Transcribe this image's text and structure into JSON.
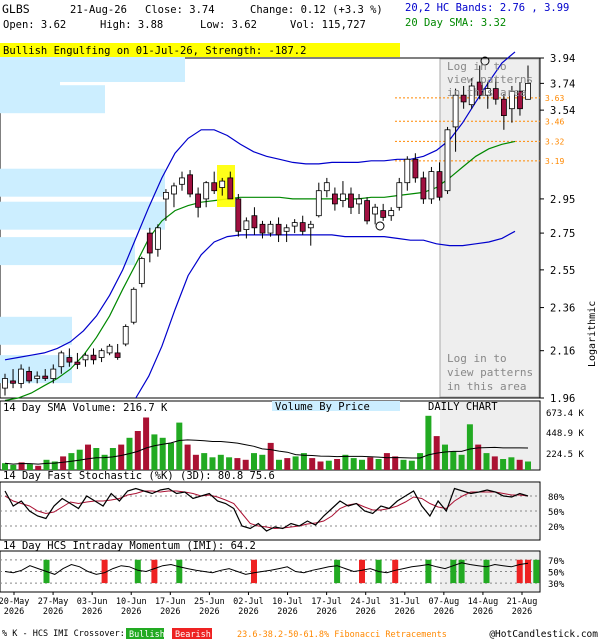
{
  "header": {
    "symbol": "GLBS",
    "date": "21-Aug-26",
    "close_label": "Close: 3.74",
    "change_label": "Change: 0.12 (+3.3 %)",
    "open_label": "Open: 3.62",
    "high_label": "High: 3.88",
    "low_label": "Low: 3.62",
    "vol_label": "Vol: 115,727",
    "bands_label": "20,2 HC Bands: 2.76 , 3.99",
    "sma_label": "20 Day SMA: 3.32"
  },
  "pattern_banner": "Bullish Engulfing on 01-Jul-26, Strength: -187.2",
  "login_text_top": [
    "Log in to",
    "view patterns",
    "in this area"
  ],
  "login_text_bottom": [
    "Log in to",
    "view patterns",
    "in this area"
  ],
  "colors": {
    "bull": "#22aa22",
    "bear": "#aa1133",
    "candle_up": "#ffffff",
    "candle_down": "#a01040",
    "bands": "#0000cc",
    "sma": "#008800",
    "fib": "#ff8800",
    "vbp": "#cceeff",
    "banner": "#ffff00"
  },
  "chart_data": {
    "type": "candlestick",
    "price_axis": {
      "scale": "log",
      "ticks": [
        1.96,
        2.16,
        2.36,
        2.55,
        2.75,
        2.95,
        3.54,
        3.74,
        3.94
      ],
      "label": "Logarithmic"
    },
    "fib_levels": [
      3.63,
      3.46,
      3.32,
      3.19
    ],
    "dates": [
      "20-May",
      "27-May",
      "03-Jun",
      "10-Jun",
      "17-Jun",
      "25-Jun",
      "02-Jul",
      "10-Jul",
      "17-Jul",
      "24-Jul",
      "31-Jul",
      "07-Aug",
      "14-Aug",
      "21-Aug"
    ],
    "date_years": [
      "2026",
      "2026",
      "2026",
      "2026",
      "2026",
      "2026",
      "2026",
      "2026",
      "2026",
      "2026",
      "2026",
      "2026",
      "2026",
      "2026"
    ],
    "candles": [
      {
        "o": 2.0,
        "h": 2.06,
        "l": 1.97,
        "c": 2.04
      },
      {
        "o": 2.03,
        "h": 2.08,
        "l": 2.0,
        "c": 2.02
      },
      {
        "o": 2.02,
        "h": 2.1,
        "l": 2.0,
        "c": 2.08
      },
      {
        "o": 2.07,
        "h": 2.09,
        "l": 2.02,
        "c": 2.03
      },
      {
        "o": 2.04,
        "h": 2.07,
        "l": 2.02,
        "c": 2.05
      },
      {
        "o": 2.05,
        "h": 2.08,
        "l": 2.03,
        "c": 2.04
      },
      {
        "o": 2.04,
        "h": 2.1,
        "l": 2.02,
        "c": 2.08
      },
      {
        "o": 2.09,
        "h": 2.16,
        "l": 2.06,
        "c": 2.15
      },
      {
        "o": 2.13,
        "h": 2.17,
        "l": 2.09,
        "c": 2.11
      },
      {
        "o": 2.11,
        "h": 2.15,
        "l": 2.08,
        "c": 2.1
      },
      {
        "o": 2.12,
        "h": 2.15,
        "l": 2.09,
        "c": 2.14
      },
      {
        "o": 2.14,
        "h": 2.17,
        "l": 2.1,
        "c": 2.12
      },
      {
        "o": 2.13,
        "h": 2.17,
        "l": 2.11,
        "c": 2.16
      },
      {
        "o": 2.15,
        "h": 2.19,
        "l": 2.14,
        "c": 2.18
      },
      {
        "o": 2.15,
        "h": 2.19,
        "l": 2.12,
        "c": 2.13
      },
      {
        "o": 2.19,
        "h": 2.28,
        "l": 2.18,
        "c": 2.27
      },
      {
        "o": 2.29,
        "h": 2.46,
        "l": 2.28,
        "c": 2.45
      },
      {
        "o": 2.48,
        "h": 2.62,
        "l": 2.46,
        "c": 2.61
      },
      {
        "o": 2.75,
        "h": 2.78,
        "l": 2.59,
        "c": 2.64
      },
      {
        "o": 2.66,
        "h": 2.8,
        "l": 2.62,
        "c": 2.78
      },
      {
        "o": 2.95,
        "h": 3.01,
        "l": 2.82,
        "c": 2.99
      },
      {
        "o": 2.98,
        "h": 3.05,
        "l": 2.9,
        "c": 3.03
      },
      {
        "o": 3.04,
        "h": 3.12,
        "l": 3.0,
        "c": 3.08
      },
      {
        "o": 3.1,
        "h": 3.13,
        "l": 2.96,
        "c": 2.98
      },
      {
        "o": 2.98,
        "h": 3.02,
        "l": 2.84,
        "c": 2.9
      },
      {
        "o": 2.95,
        "h": 3.06,
        "l": 2.9,
        "c": 3.05
      },
      {
        "o": 3.05,
        "h": 3.12,
        "l": 2.98,
        "c": 3.0
      },
      {
        "o": 3.02,
        "h": 3.08,
        "l": 2.97,
        "c": 3.06
      },
      {
        "o": 3.08,
        "h": 3.12,
        "l": 3.02,
        "c": 2.95
      },
      {
        "o": 2.95,
        "h": 2.98,
        "l": 2.73,
        "c": 2.76
      },
      {
        "o": 2.77,
        "h": 2.84,
        "l": 2.72,
        "c": 2.82
      },
      {
        "o": 2.85,
        "h": 2.9,
        "l": 2.74,
        "c": 2.78
      },
      {
        "o": 2.8,
        "h": 2.82,
        "l": 2.72,
        "c": 2.75
      },
      {
        "o": 2.75,
        "h": 2.82,
        "l": 2.73,
        "c": 2.8
      },
      {
        "o": 2.8,
        "h": 2.84,
        "l": 2.7,
        "c": 2.74
      },
      {
        "o": 2.76,
        "h": 2.8,
        "l": 2.7,
        "c": 2.78
      },
      {
        "o": 2.79,
        "h": 2.83,
        "l": 2.75,
        "c": 2.81
      },
      {
        "o": 2.81,
        "h": 2.85,
        "l": 2.74,
        "c": 2.76
      },
      {
        "o": 2.78,
        "h": 2.82,
        "l": 2.68,
        "c": 2.8
      },
      {
        "o": 2.85,
        "h": 3.05,
        "l": 2.84,
        "c": 3.0
      },
      {
        "o": 3.0,
        "h": 3.08,
        "l": 2.96,
        "c": 3.05
      },
      {
        "o": 2.98,
        "h": 3.02,
        "l": 2.88,
        "c": 2.92
      },
      {
        "o": 2.94,
        "h": 3.06,
        "l": 2.9,
        "c": 2.98
      },
      {
        "o": 2.98,
        "h": 3.02,
        "l": 2.86,
        "c": 2.9
      },
      {
        "o": 2.92,
        "h": 2.98,
        "l": 2.86,
        "c": 2.95
      },
      {
        "o": 2.94,
        "h": 2.96,
        "l": 2.8,
        "c": 2.82
      },
      {
        "o": 2.86,
        "h": 2.92,
        "l": 2.8,
        "c": 2.9
      },
      {
        "o": 2.88,
        "h": 2.92,
        "l": 2.82,
        "c": 2.84
      },
      {
        "o": 2.85,
        "h": 2.9,
        "l": 2.82,
        "c": 2.88
      },
      {
        "o": 2.9,
        "h": 3.08,
        "l": 2.88,
        "c": 3.05
      },
      {
        "o": 3.05,
        "h": 3.22,
        "l": 3.0,
        "c": 3.2
      },
      {
        "o": 3.2,
        "h": 3.24,
        "l": 3.05,
        "c": 3.08
      },
      {
        "o": 3.08,
        "h": 3.12,
        "l": 2.92,
        "c": 2.95
      },
      {
        "o": 2.95,
        "h": 3.15,
        "l": 2.92,
        "c": 3.12
      },
      {
        "o": 3.12,
        "h": 3.18,
        "l": 2.94,
        "c": 2.96
      },
      {
        "o": 3.0,
        "h": 3.42,
        "l": 2.98,
        "c": 3.4
      },
      {
        "o": 3.42,
        "h": 3.7,
        "l": 3.25,
        "c": 3.65
      },
      {
        "o": 3.65,
        "h": 3.72,
        "l": 3.55,
        "c": 3.6
      },
      {
        "o": 3.58,
        "h": 3.78,
        "l": 3.55,
        "c": 3.72
      },
      {
        "o": 3.75,
        "h": 3.88,
        "l": 3.62,
        "c": 3.65
      },
      {
        "o": 3.65,
        "h": 3.75,
        "l": 3.55,
        "c": 3.7
      },
      {
        "o": 3.7,
        "h": 3.78,
        "l": 3.58,
        "c": 3.62
      },
      {
        "o": 3.62,
        "h": 3.66,
        "l": 3.4,
        "c": 3.5
      },
      {
        "o": 3.55,
        "h": 3.72,
        "l": 3.45,
        "c": 3.68
      },
      {
        "o": 3.68,
        "h": 3.75,
        "l": 3.5,
        "c": 3.55
      },
      {
        "o": 3.62,
        "h": 3.88,
        "l": 3.62,
        "c": 3.74
      }
    ],
    "upper_band": [
      2.12,
      2.13,
      2.14,
      2.15,
      2.17,
      2.2,
      2.25,
      2.32,
      2.42,
      2.55,
      2.72,
      2.9,
      3.08,
      3.24,
      3.34,
      3.4,
      3.4,
      3.36,
      3.3,
      3.25,
      3.22,
      3.2,
      3.18,
      3.17,
      3.17,
      3.18,
      3.18,
      3.18,
      3.19,
      3.19,
      3.2,
      3.2,
      3.22,
      3.26,
      3.33,
      3.45,
      3.6,
      3.75,
      3.9,
      3.99
    ],
    "lower_band": [
      null,
      null,
      null,
      null,
      null,
      null,
      null,
      null,
      null,
      null,
      1.96,
      2.05,
      2.18,
      2.35,
      2.52,
      2.63,
      2.7,
      2.73,
      2.74,
      2.74,
      2.74,
      2.74,
      2.74,
      2.74,
      2.74,
      2.74,
      2.73,
      2.73,
      2.73,
      2.73,
      2.72,
      2.71,
      2.71,
      2.69,
      2.68,
      2.68,
      2.69,
      2.7,
      2.72,
      2.76
    ],
    "sma20": [
      1.95,
      1.96,
      1.98,
      2.01,
      2.04,
      2.08,
      2.14,
      2.22,
      2.32,
      2.45,
      2.58,
      2.72,
      2.82,
      2.88,
      2.91,
      2.93,
      2.94,
      2.95,
      2.96,
      2.96,
      2.96,
      2.96,
      2.95,
      2.95,
      2.95,
      2.95,
      2.95,
      2.95,
      2.96,
      2.96,
      2.97,
      2.98,
      2.99,
      3.02,
      3.08,
      3.15,
      3.22,
      3.27,
      3.3,
      3.32
    ],
    "vbp_bars": [
      {
        "price": 3.86,
        "len": 185
      },
      {
        "price": 3.75,
        "len": 60
      },
      {
        "price": 3.62,
        "len": 105
      },
      {
        "price": 3.35,
        "len": 0
      },
      {
        "price": 3.05,
        "len": 165
      },
      {
        "price": 2.85,
        "len": 165
      },
      {
        "price": 2.65,
        "len": 135
      },
      {
        "price": 2.25,
        "len": 72
      },
      {
        "price": 2.08,
        "len": 72
      }
    ],
    "volume": {
      "title": "14 Day SMA Volume: 216.7 K",
      "axis_ticks": [
        "673.4 K",
        "448.9 K",
        "224.5 K"
      ],
      "subtitle": "Volume By Price",
      "right_label": "DAILY CHART",
      "bars": [
        {
          "v": 80,
          "up": true
        },
        {
          "v": 60,
          "up": true
        },
        {
          "v": 90,
          "up": false
        },
        {
          "v": 70,
          "up": true
        },
        {
          "v": 50,
          "up": false
        },
        {
          "v": 120,
          "up": true
        },
        {
          "v": 100,
          "up": true
        },
        {
          "v": 160,
          "up": false
        },
        {
          "v": 200,
          "up": true
        },
        {
          "v": 240,
          "up": true
        },
        {
          "v": 300,
          "up": false
        },
        {
          "v": 260,
          "up": true
        },
        {
          "v": 180,
          "up": true
        },
        {
          "v": 260,
          "up": true
        },
        {
          "v": 300,
          "up": false
        },
        {
          "v": 380,
          "up": true
        },
        {
          "v": 460,
          "up": false
        },
        {
          "v": 620,
          "up": false
        },
        {
          "v": 420,
          "up": true
        },
        {
          "v": 380,
          "up": true
        },
        {
          "v": 320,
          "up": true
        },
        {
          "v": 560,
          "up": true
        },
        {
          "v": 300,
          "up": false
        },
        {
          "v": 180,
          "up": false
        },
        {
          "v": 200,
          "up": true
        },
        {
          "v": 150,
          "up": true
        },
        {
          "v": 180,
          "up": true
        },
        {
          "v": 150,
          "up": true
        },
        {
          "v": 140,
          "up": false
        },
        {
          "v": 120,
          "up": false
        },
        {
          "v": 200,
          "up": true
        },
        {
          "v": 180,
          "up": true
        },
        {
          "v": 320,
          "up": false
        },
        {
          "v": 120,
          "up": true
        },
        {
          "v": 140,
          "up": false
        },
        {
          "v": 160,
          "up": true
        },
        {
          "v": 200,
          "up": true
        },
        {
          "v": 140,
          "up": false
        },
        {
          "v": 100,
          "up": false
        },
        {
          "v": 110,
          "up": true
        },
        {
          "v": 130,
          "up": false
        },
        {
          "v": 180,
          "up": true
        },
        {
          "v": 140,
          "up": true
        },
        {
          "v": 120,
          "up": true
        },
        {
          "v": 150,
          "up": false
        },
        {
          "v": 130,
          "up": true
        },
        {
          "v": 200,
          "up": false
        },
        {
          "v": 160,
          "up": false
        },
        {
          "v": 120,
          "up": true
        },
        {
          "v": 110,
          "up": true
        },
        {
          "v": 200,
          "up": true
        },
        {
          "v": 640,
          "up": true
        },
        {
          "v": 400,
          "up": false
        },
        {
          "v": 300,
          "up": true
        },
        {
          "v": 220,
          "up": true
        },
        {
          "v": 180,
          "up": true
        },
        {
          "v": 540,
          "up": true
        },
        {
          "v": 300,
          "up": false
        },
        {
          "v": 200,
          "up": true
        },
        {
          "v": 160,
          "up": false
        },
        {
          "v": 130,
          "up": true
        },
        {
          "v": 150,
          "up": true
        },
        {
          "v": 120,
          "up": false
        },
        {
          "v": 100,
          "up": true
        }
      ]
    },
    "stochastic": {
      "title": "14 Day Fast Stochastic (%K) (3D): 80.8   75.6",
      "axis_ticks": [
        "80%",
        "50%",
        "20%"
      ],
      "k": [
        90,
        60,
        70,
        50,
        40,
        35,
        60,
        75,
        65,
        55,
        80,
        70,
        60,
        85,
        70,
        90,
        95,
        90,
        85,
        92,
        95,
        85,
        88,
        75,
        80,
        85,
        70,
        65,
        55,
        20,
        15,
        25,
        10,
        18,
        15,
        25,
        20,
        30,
        22,
        40,
        55,
        70,
        60,
        65,
        50,
        45,
        60,
        55,
        70,
        80,
        90,
        60,
        40,
        70,
        50,
        95,
        90,
        85,
        88,
        92,
        88,
        80,
        78,
        85,
        80
      ],
      "d": [
        80,
        70,
        65,
        60,
        50,
        45,
        48,
        58,
        68,
        65,
        68,
        70,
        70,
        72,
        75,
        82,
        85,
        90,
        90,
        88,
        90,
        90,
        88,
        85,
        80,
        82,
        78,
        72,
        65,
        45,
        25,
        20,
        18,
        15,
        16,
        18,
        20,
        24,
        26,
        30,
        40,
        55,
        62,
        65,
        58,
        52,
        52,
        55,
        60,
        68,
        78,
        75,
        65,
        58,
        55,
        70,
        80,
        88,
        88,
        88,
        88,
        85,
        82,
        82,
        80
      ]
    },
    "imi": {
      "title": "14 Day HCS Intraday Momentum (IMI): 64.2",
      "axis_ticks": [
        "70%",
        "50%",
        "30%"
      ],
      "line": [
        50,
        48,
        52,
        60,
        55,
        50,
        45,
        55,
        62,
        58,
        50,
        45,
        48,
        55,
        60,
        58,
        52,
        50,
        55,
        60,
        62,
        58,
        55,
        52,
        50,
        48,
        52,
        55,
        50,
        45,
        48,
        50,
        52,
        55,
        58,
        50,
        48,
        52,
        55,
        58,
        60,
        55,
        50,
        52,
        55,
        50,
        48,
        52,
        55,
        58,
        60,
        62,
        58,
        55,
        60,
        65,
        62,
        60,
        58,
        62,
        60,
        58,
        62,
        64
      ],
      "signals": [
        {
          "i": 5,
          "type": "bull"
        },
        {
          "i": 12,
          "type": "bear"
        },
        {
          "i": 16,
          "type": "bull"
        },
        {
          "i": 18,
          "type": "bear"
        },
        {
          "i": 21,
          "type": "bull"
        },
        {
          "i": 30,
          "type": "bear"
        },
        {
          "i": 40,
          "type": "bull"
        },
        {
          "i": 43,
          "type": "bear"
        },
        {
          "i": 45,
          "type": "bull"
        },
        {
          "i": 47,
          "type": "bear"
        },
        {
          "i": 51,
          "type": "bull"
        },
        {
          "i": 54,
          "type": "bull"
        },
        {
          "i": 55,
          "type": "bull"
        },
        {
          "i": 58,
          "type": "bull"
        },
        {
          "i": 62,
          "type": "bear"
        },
        {
          "i": 63,
          "type": "bear"
        },
        {
          "i": 64,
          "type": "bull"
        }
      ]
    }
  },
  "footer": {
    "crossover_label": "% K - HCS IMI Crossover:",
    "bullish_label": "Bullish",
    "bearish_label": "Bearish",
    "fib_label": "23.6-38.2-50-61.8% Fibonacci Retracements",
    "copyright": "@HotCandlestick.com"
  }
}
